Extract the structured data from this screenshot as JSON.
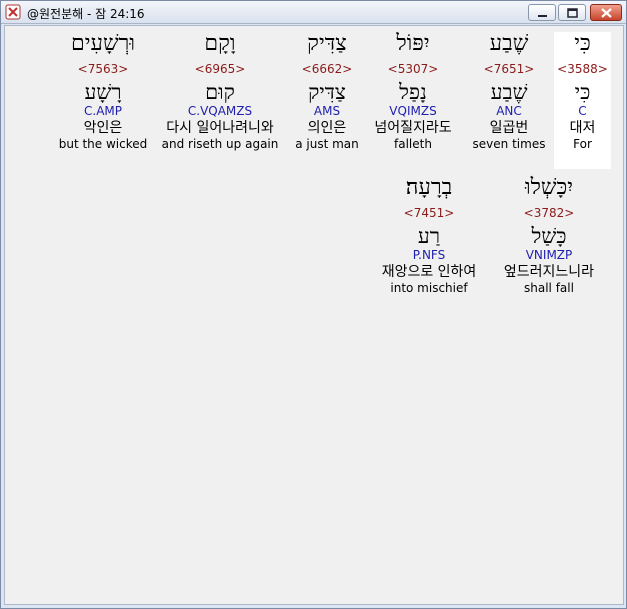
{
  "window": {
    "title": "@원전분해 - 잠 24:16"
  },
  "row1": [
    {
      "hebrew": "כִּי",
      "strongs": "<3588>",
      "lemma": "כִּי",
      "morph": "C",
      "korean": "대저",
      "english": "For"
    },
    {
      "hebrew": "שֶׁבַע",
      "strongs": "<7651>",
      "lemma": "שֶׁבַע",
      "morph": "ANC",
      "korean": "일곱번",
      "english": "seven times"
    },
    {
      "hebrew": "יִפּוֹל",
      "strongs": "<5307>",
      "lemma": "נָפַל",
      "morph": "VQIMZS",
      "korean": "넘어질지라도",
      "english": "falleth"
    },
    {
      "hebrew": "צַדִּיק",
      "strongs": "<6662>",
      "lemma": "צַדִּיק",
      "morph": "AMS",
      "korean": "의인은",
      "english": "a just man"
    },
    {
      "hebrew": "וָקָם",
      "strongs": "<6965>",
      "lemma": "קוּם",
      "morph": "C.VQAMZS",
      "korean": "다시 일어나려니와",
      "english": "and riseth up again"
    },
    {
      "hebrew": "וּרְשָׁעִים",
      "strongs": "<7563>",
      "lemma": "רָשָׁע",
      "morph": "C.AMP",
      "korean": "악인은",
      "english": "but the wicked"
    }
  ],
  "row2": [
    {
      "hebrew": "יִכָּשְׁלוּ",
      "strongs": "<3782>",
      "lemma": "כָּשַׁל",
      "morph": "VNIMZP",
      "korean": "엎드러지느니라",
      "english": "shall fall"
    },
    {
      "hebrew": "בְרָעָה׃",
      "strongs": "<7451>",
      "lemma": "רַע",
      "morph": "P.NFS",
      "korean": "재앙으로 인하여",
      "english": "into mischief"
    }
  ]
}
